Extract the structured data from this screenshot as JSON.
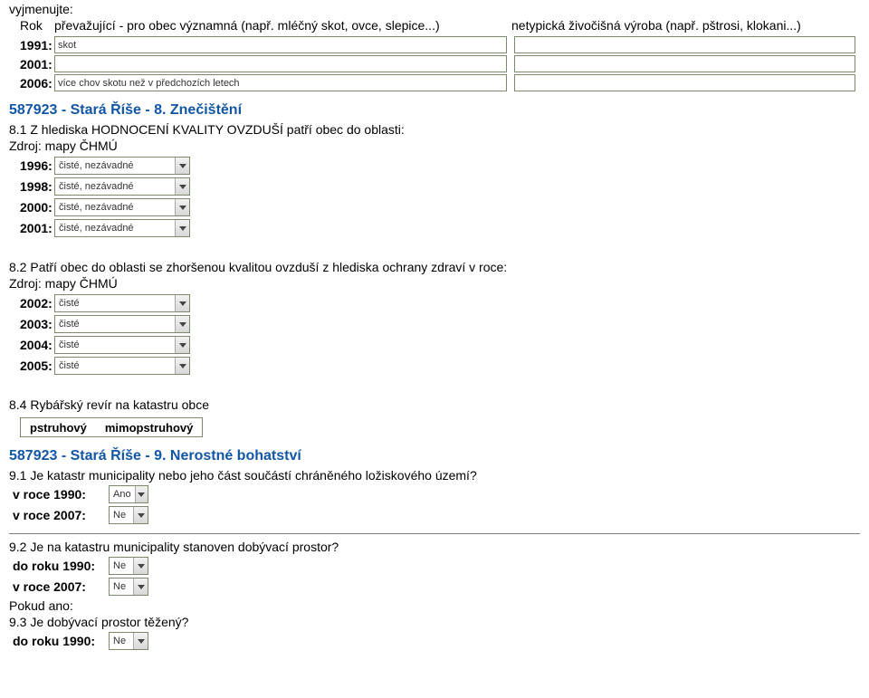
{
  "intro": {
    "vyjmenujte": "vyjmenujte:",
    "rok": "Rok",
    "prevazujici": "převažující - pro obec významná (např. mléčný skot, ovce, slepice...)",
    "netypicka": "netypická živočišná výroba (např. pštrosi, klokani...)"
  },
  "livestock": {
    "rows": [
      {
        "year": "1991:",
        "left": "skot",
        "right": ""
      },
      {
        "year": "2001:",
        "left": "",
        "right": ""
      },
      {
        "year": "2006:",
        "left": "více chov skotu než v předchozích letech",
        "right": ""
      }
    ]
  },
  "sec8": {
    "title": "587923 - Stará Říše - 8. Znečištění",
    "q81": "8.1 Z hlediska HODNOCENÍ KVALITY OVZDUŠÍ patří obec do oblasti:",
    "q82": "8.2 Patří obec do oblasti se zhoršenou kvalitou ovzduší z hlediska ochrany zdraví v roce:",
    "source": "Zdroj: mapy ČHMÚ",
    "rows81": [
      {
        "year": "1996:",
        "value": "čisté, nezávadné"
      },
      {
        "year": "1998:",
        "value": "čisté, nezávadné"
      },
      {
        "year": "2000:",
        "value": "čisté, nezávadné"
      },
      {
        "year": "2001:",
        "value": "čisté, nezávadné"
      }
    ],
    "rows82": [
      {
        "year": "2002:",
        "value": "čisté"
      },
      {
        "year": "2003:",
        "value": "čisté"
      },
      {
        "year": "2004:",
        "value": "čisté"
      },
      {
        "year": "2005:",
        "value": "čisté"
      }
    ],
    "q84": "8.4 Rybářský revír na katastru obce",
    "opts84": {
      "a": "pstruhový",
      "b": "mimopstruhový"
    }
  },
  "sec9": {
    "title": "587923 - Stará Říše - 9. Nerostné bohatství",
    "q91": "9.1 Je katastr municipality nebo jeho část součástí chráněného ložiskového území?",
    "rows91": [
      {
        "label": "v roce 1990:",
        "value": "Ano"
      },
      {
        "label": "v roce 2007:",
        "value": "Ne"
      }
    ],
    "q92": "9.2 Je na katastru municipality stanoven dobývací prostor?",
    "rows92": [
      {
        "label": "do roku 1990:",
        "value": "Ne"
      },
      {
        "label": "v roce 2007:",
        "value": "Ne"
      }
    ],
    "pokud": "Pokud ano:",
    "q93": "9.3 Je dobývací prostor těžený?",
    "rows93": [
      {
        "label": "do roku 1990:",
        "value": "Ne"
      }
    ]
  }
}
